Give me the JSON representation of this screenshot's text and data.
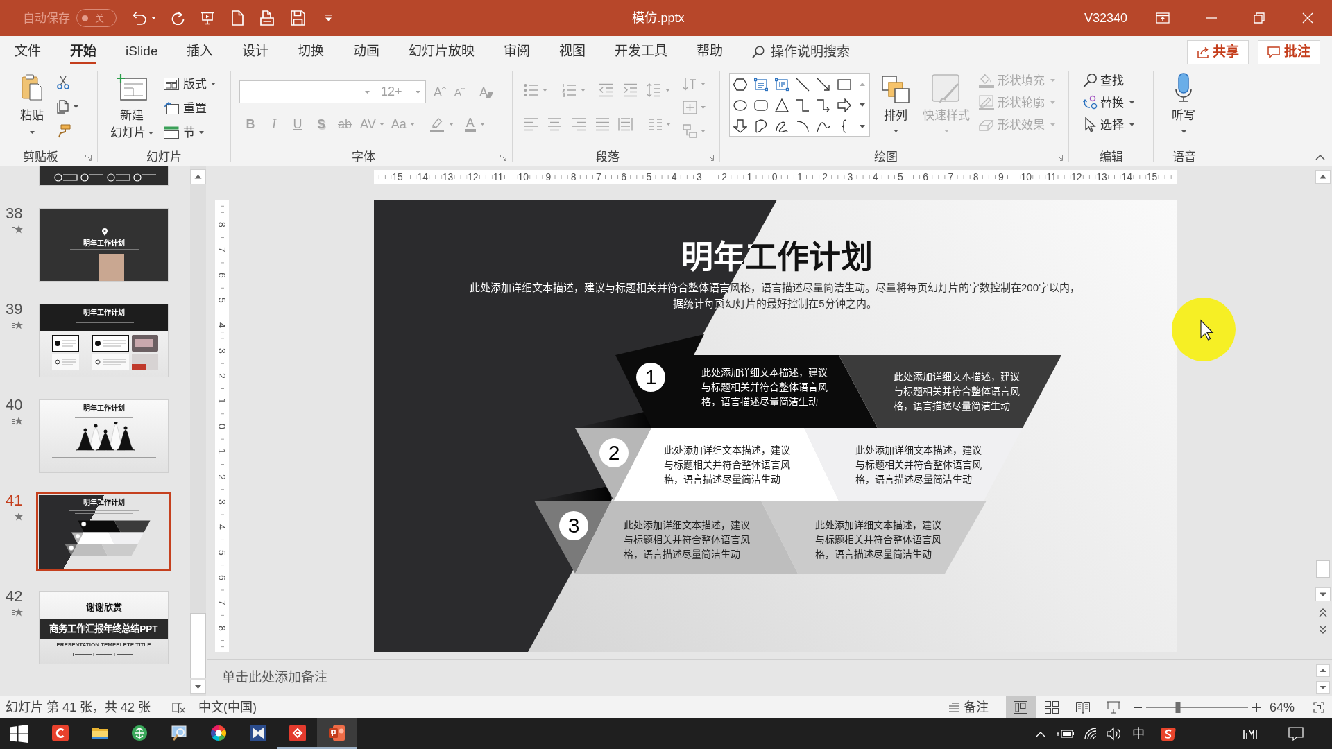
{
  "title_bar": {
    "autosave_label": "自动保存",
    "autosave_on": false,
    "autosave_state": "关",
    "document_title": "模仿.pptx",
    "user": "V32340"
  },
  "menu_tabs": [
    {
      "label": "文件",
      "selected": false
    },
    {
      "label": "开始",
      "selected": true
    },
    {
      "label": "iSlide",
      "selected": false
    },
    {
      "label": "插入",
      "selected": false
    },
    {
      "label": "设计",
      "selected": false
    },
    {
      "label": "切换",
      "selected": false
    },
    {
      "label": "动画",
      "selected": false
    },
    {
      "label": "幻灯片放映",
      "selected": false
    },
    {
      "label": "审阅",
      "selected": false
    },
    {
      "label": "视图",
      "selected": false
    },
    {
      "label": "开发工具",
      "selected": false
    },
    {
      "label": "帮助",
      "selected": false
    }
  ],
  "tell_me": {
    "placeholder": "操作说明搜索"
  },
  "share_button": "共享",
  "comments_button": "批注",
  "ribbon": {
    "groups": [
      {
        "kind": "clipboard",
        "label": "剪贴板",
        "launcher": true,
        "paste": "粘贴"
      },
      {
        "kind": "slides",
        "label": "幻灯片",
        "launcher": false,
        "new_slide": [
          "新建",
          "幻灯片"
        ],
        "items": [
          {
            "kind": "layout",
            "label": "版式",
            "dropdown": true
          },
          {
            "kind": "reset",
            "label": "重置",
            "dropdown": false
          },
          {
            "kind": "section",
            "label": "节",
            "dropdown": true
          }
        ]
      },
      {
        "kind": "font",
        "label": "字体",
        "launcher": true,
        "disabled": true,
        "font_size": "12+",
        "size_buttons": [
          "Aˆ",
          "Aˇ"
        ],
        "clear_button": "A",
        "format_buttons": [
          {
            "kind": "bold",
            "text": "B",
            "dropdown": false
          },
          {
            "kind": "italic",
            "text": "I",
            "dropdown": false
          },
          {
            "kind": "underline",
            "text": "U",
            "dropdown": false
          },
          {
            "kind": "shadow",
            "text": "S",
            "dropdown": false
          },
          {
            "kind": "strike",
            "text": "ab",
            "dropdown": false
          },
          {
            "kind": "spacing",
            "text": "AV",
            "dropdown": true
          },
          {
            "kind": "case",
            "text": "Aa",
            "dropdown": true
          }
        ],
        "font_color": "A"
      },
      {
        "kind": "paragraph",
        "label": "段落",
        "launcher": true,
        "disabled": true
      },
      {
        "kind": "drawing",
        "label": "绘图",
        "launcher": true,
        "arrange": "排列",
        "quick_styles": {
          "label": "快速样式",
          "disabled": true
        },
        "shape_format": [
          {
            "kind": "fill",
            "label": "形状填充",
            "disabled": true
          },
          {
            "kind": "outline",
            "label": "形状轮廓",
            "disabled": true
          },
          {
            "kind": "effects",
            "label": "形状效果",
            "disabled": true
          }
        ]
      },
      {
        "kind": "editing",
        "label": "编辑",
        "launcher": false,
        "items": [
          {
            "kind": "find",
            "label": "查找",
            "dropdown": false
          },
          {
            "kind": "replace",
            "label": "替换",
            "dropdown": true
          },
          {
            "kind": "select",
            "label": "选择",
            "dropdown": true
          }
        ]
      },
      {
        "kind": "voice",
        "label": "语音",
        "launcher": false,
        "dictate": "听写"
      }
    ]
  },
  "slide_panel": {
    "slides": [
      {
        "number": "38",
        "selected": false,
        "animated": true,
        "kind": "photo-title",
        "title": "明年工作计划"
      },
      {
        "number": "39",
        "selected": false,
        "animated": true,
        "kind": "cards",
        "title": "明年工作计划"
      },
      {
        "number": "40",
        "selected": false,
        "animated": true,
        "kind": "peaks",
        "title": "明年工作计划"
      },
      {
        "number": "41",
        "selected": true,
        "animated": true,
        "kind": "bands",
        "title": "明年工作计划"
      },
      {
        "number": "42",
        "selected": false,
        "animated": true,
        "kind": "closing",
        "title": "谢谢欣赏",
        "subtitle": "商务工作汇报年终总结PPT",
        "caption": "PRESENTATION TEMPELETE TITLE"
      }
    ]
  },
  "rulers": {
    "horizontal": [
      "15",
      "14",
      "13",
      "12",
      "11",
      "10",
      "9",
      "8",
      "7",
      "6",
      "5",
      "4",
      "3",
      "2",
      "1",
      "0",
      "1",
      "2",
      "3",
      "4",
      "5",
      "6",
      "7",
      "8",
      "9",
      "10",
      "11",
      "12",
      "13",
      "14",
      "15"
    ],
    "vertical": [
      "8",
      "7",
      "6",
      "5",
      "4",
      "3",
      "2",
      "1",
      "0",
      "1",
      "2",
      "3",
      "4",
      "5",
      "6",
      "7",
      "8"
    ]
  },
  "slide": {
    "title": "明年工作计划",
    "description": "此处添加详细文本描述，建议与标题相关并符合整体语言风格，语言描述尽量简洁生动。尽量将每页幻灯片的字数控制在200字以内，据统计每页幻灯片的最好控制在5分钟之内。",
    "steps": [
      {
        "number": "1",
        "kind": "dark",
        "texts": [
          "此处添加详细文本描述，建议与标题相关并符合整体语言风格，语言描述尽量简洁生动",
          "此处添加详细文本描述，建议与标题相关并符合整体语言风格，语言描述尽量简洁生动"
        ]
      },
      {
        "number": "2",
        "kind": "light",
        "texts": [
          "此处添加详细文本描述，建议与标题相关并符合整体语言风格，语言描述尽量简洁生动",
          "此处添加详细文本描述，建议与标题相关并符合整体语言风格，语言描述尽量简洁生动"
        ]
      },
      {
        "number": "3",
        "kind": "grey",
        "texts": [
          "此处添加详细文本描述，建议与标题相关并符合整体语言风格，语言描述尽量简洁生动",
          "此处添加详细文本描述，建议与标题相关并符合整体语言风格，语言描述尽量简洁生动"
        ]
      }
    ]
  },
  "notes": {
    "placeholder": "单击此处添加备注"
  },
  "status_bar": {
    "slide_info": "幻灯片 第 41 张，共 42 张",
    "language": "中文(中国)",
    "notes_button": "备注",
    "views": [
      {
        "kind": "normal",
        "selected": true
      },
      {
        "kind": "sorter",
        "selected": false
      },
      {
        "kind": "reading",
        "selected": false
      },
      {
        "kind": "slideshow",
        "selected": false
      }
    ],
    "zoom": {
      "level": 0.31,
      "value": "64%"
    }
  },
  "taskbar": {
    "apps": [
      {
        "kind": "c-app",
        "active": false,
        "running": false
      },
      {
        "kind": "folder",
        "active": false,
        "running": false
      },
      {
        "kind": "globe",
        "active": false,
        "running": false
      },
      {
        "kind": "magnifier",
        "active": false,
        "running": false
      },
      {
        "kind": "color-wheel",
        "active": false,
        "running": false
      },
      {
        "kind": "book",
        "active": false,
        "running": false
      },
      {
        "kind": "diamond",
        "active": false,
        "running": true
      },
      {
        "kind": "presentation",
        "active": true,
        "running": true
      }
    ],
    "ime": "中"
  }
}
